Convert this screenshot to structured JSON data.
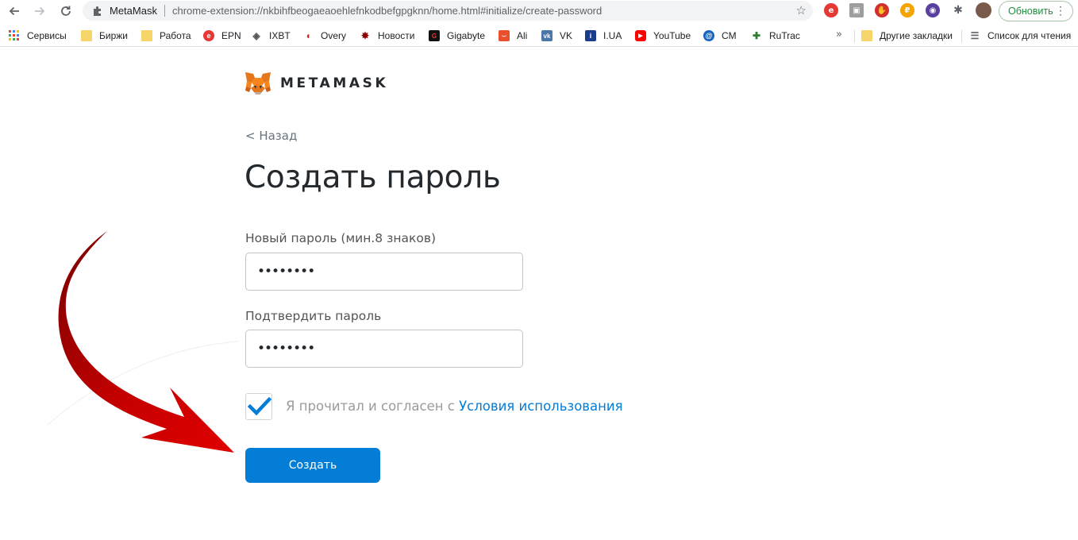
{
  "browser": {
    "site_name": "MetaMask",
    "url": "chrome-extension://nkbihfbeogaeaoehlefnkodbefgpgknn/home.html#initialize/create-password",
    "update_label": "Обновить"
  },
  "bookmarks": {
    "items": [
      {
        "label": "Сервисы",
        "icon": "apps-grid-icon"
      },
      {
        "label": "Биржи",
        "icon": "folder-icon"
      },
      {
        "label": "Работа",
        "icon": "folder-icon"
      },
      {
        "label": "EPN",
        "icon": "epn-icon"
      },
      {
        "label": "IXBT",
        "icon": "ixbt-icon"
      },
      {
        "label": "Overy",
        "icon": "overy-icon"
      },
      {
        "label": "Новости",
        "icon": "news-icon"
      },
      {
        "label": "Gigabyte",
        "icon": "gigabyte-icon"
      },
      {
        "label": "Ali",
        "icon": "aliexpress-icon"
      },
      {
        "label": "VK",
        "icon": "vk-icon"
      },
      {
        "label": "I.UA",
        "icon": "iua-icon"
      },
      {
        "label": "YouTube",
        "icon": "youtube-icon"
      },
      {
        "label": "CM",
        "icon": "cm-icon"
      },
      {
        "label": "RuTrac",
        "icon": "rutracker-icon"
      }
    ],
    "other_label": "Другие закладки",
    "reading_list_label": "Список для чтения"
  },
  "page": {
    "brand": "METAMASK",
    "back_label": "< Назад",
    "title": "Создать пароль",
    "new_password_label": "Новый пароль (мин.8 знаков)",
    "new_password_value": "••••••••",
    "confirm_password_label": "Подтвердить пароль",
    "confirm_password_value": "••••••••",
    "terms_text": "Я прочитал и согласен с ",
    "terms_link": "Условия использования",
    "terms_checked": true,
    "create_label": "Создать"
  },
  "colors": {
    "primary": "#037dd6",
    "arrow": "#d40000"
  }
}
